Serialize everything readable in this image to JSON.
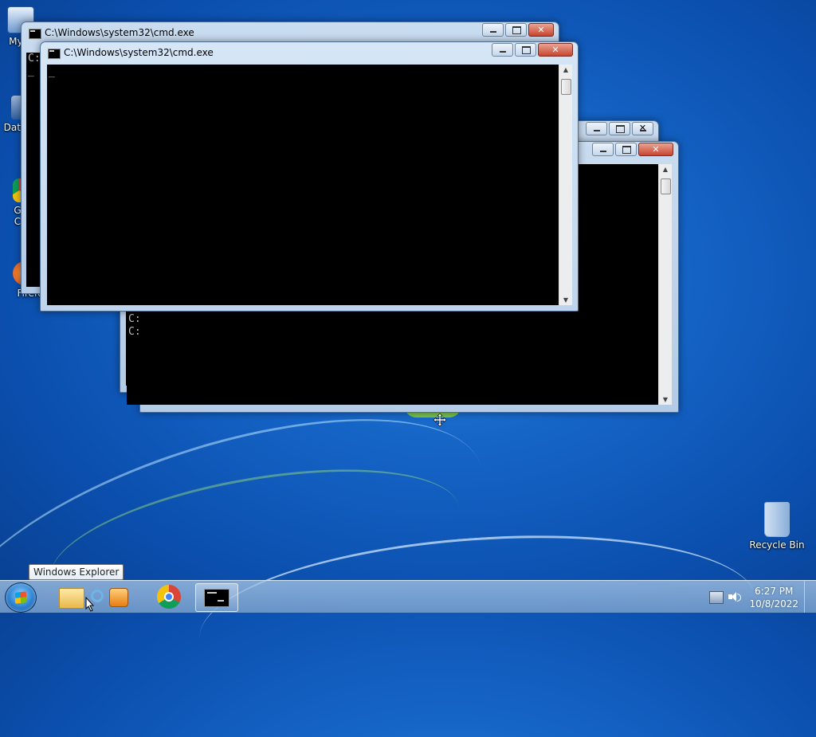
{
  "desktop": {
    "icons": [
      {
        "label": "My C",
        "icon": "computer-icon"
      },
      {
        "label": "Data",
        "icon": "database-shortcut-icon"
      },
      {
        "label": "G",
        "label2": "C",
        "icon": "chrome-shortcut-icon"
      },
      {
        "label": "Firefo",
        "icon": "firefox-shortcut-icon"
      },
      {
        "label": "Recycle Bin",
        "icon": "recycle-bin-icon"
      }
    ]
  },
  "windows": {
    "cmd1": {
      "title": "C:\\Windows\\system32\\cmd.exe",
      "text": "C:\n_"
    },
    "cmd2": {
      "title": "C:\\Windows\\system32\\cmd.exe",
      "text": "_"
    },
    "cmd3": {
      "text": ""
    },
    "cmd4": {
      "text": "C:\nC:"
    }
  },
  "taskbar": {
    "tooltip": "Windows Explorer",
    "items": [
      {
        "name": "windows-explorer",
        "icon": "folder-icon"
      },
      {
        "name": "internet-explorer",
        "icon": "ie-icon"
      },
      {
        "name": "media-player",
        "icon": "media-player-icon"
      },
      {
        "name": "chrome",
        "icon": "chrome-icon"
      },
      {
        "name": "command-prompt",
        "icon": "cmd-icon"
      }
    ],
    "clock": {
      "time": "6:27 PM",
      "date": "10/8/2022"
    }
  },
  "colors": {
    "console_bg": "#000000",
    "desktop": "#1565c7",
    "close_button": "#c9452f"
  }
}
